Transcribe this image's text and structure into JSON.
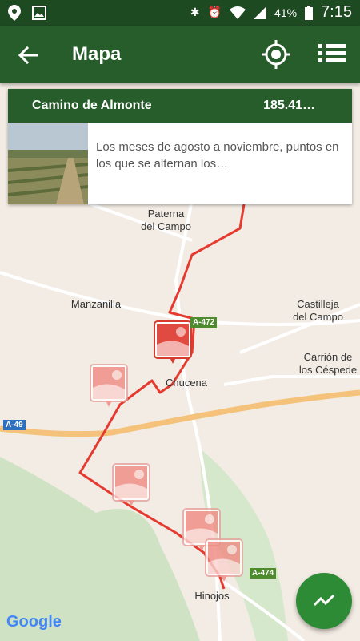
{
  "status_bar": {
    "battery": "41%",
    "time": "7:15"
  },
  "app_bar": {
    "title": "Mapa"
  },
  "route_card": {
    "title": "Camino de Almonte",
    "distance": "185.41…",
    "description": "Los meses de agosto a noviembre, puntos en los que se alternan los…"
  },
  "map": {
    "places": [
      {
        "name": "Paterna del Campo",
        "lines": [
          "Paterna",
          "del Campo"
        ]
      },
      {
        "name": "Manzanilla",
        "lines": [
          "Manzanilla"
        ]
      },
      {
        "name": "Castilleja del Campo",
        "lines": [
          "Castilleja",
          "del Campo"
        ]
      },
      {
        "name": "Carrión de los Céspedes",
        "lines": [
          "Carrión de",
          "los Céspede"
        ]
      },
      {
        "name": "Chucena",
        "lines": [
          "Chucena"
        ]
      },
      {
        "name": "Hinojos",
        "lines": [
          "Hinojos"
        ]
      }
    ],
    "road_badges": [
      {
        "label": "A-472",
        "color": "#4e8a2e"
      },
      {
        "label": "A-49",
        "color": "#2c6fbf"
      },
      {
        "label": "A-474",
        "color": "#4e8a2e"
      }
    ],
    "attribution": "Google"
  },
  "colors": {
    "app_bar": "#275d2b",
    "status_bar": "#1e4a22",
    "route": "#e53a30",
    "fab": "#2e8b35"
  },
  "icons": [
    "back-arrow-icon",
    "my-location-icon",
    "list-icon",
    "trend-icon",
    "poi-marker-icon"
  ]
}
